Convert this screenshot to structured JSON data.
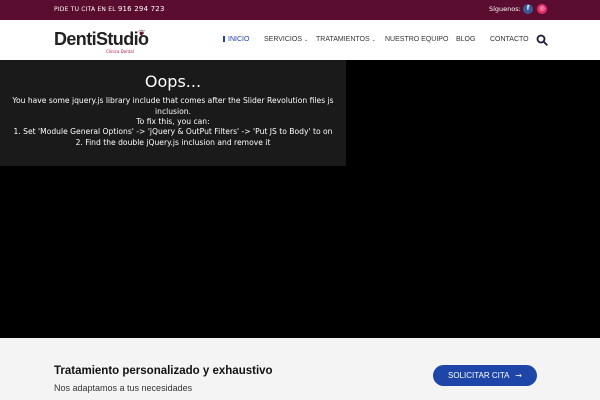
{
  "colors": {
    "topbar_bg": "#5a0d2e",
    "accent": "#1e45a8",
    "brand_pink": "#b0124e"
  },
  "topbar": {
    "phone_label": "PIDE TU CITA EN EL",
    "phone_number": "916 294 723",
    "follow_label": "Síguenos:",
    "social": [
      {
        "icon": "facebook-icon",
        "glyph": "f"
      },
      {
        "icon": "instagram-icon",
        "glyph": "◎"
      }
    ]
  },
  "header": {
    "logo_word": "DentiStudio",
    "logo_sub": "Clínica Dental",
    "nav": [
      "INICIO",
      "SERVICIOS",
      "TRATAMIENTOS",
      "NUESTRO EQUIPO",
      "BLOG",
      "CONTACTO"
    ],
    "search_icon": "search-icon"
  },
  "slider_error": {
    "title": "Oops...",
    "message": "You have some jquery.js library include that comes after the Slider Revolution files js inclusion.",
    "fix_intro": "To fix this, you can:",
    "steps": [
      "1. Set 'Module General Options' -> 'jQuery & OutPut Filters' -> 'Put JS to Body' to on",
      "2. Find the double jQuery.js inclusion and remove it"
    ]
  },
  "cta": {
    "heading": "Tratamiento personalizado y exhaustivo",
    "subheading": "Nos adaptamos a tus necesidades",
    "button_label": "SOLICITAR CITA",
    "button_icon": "arrow-right-icon"
  }
}
